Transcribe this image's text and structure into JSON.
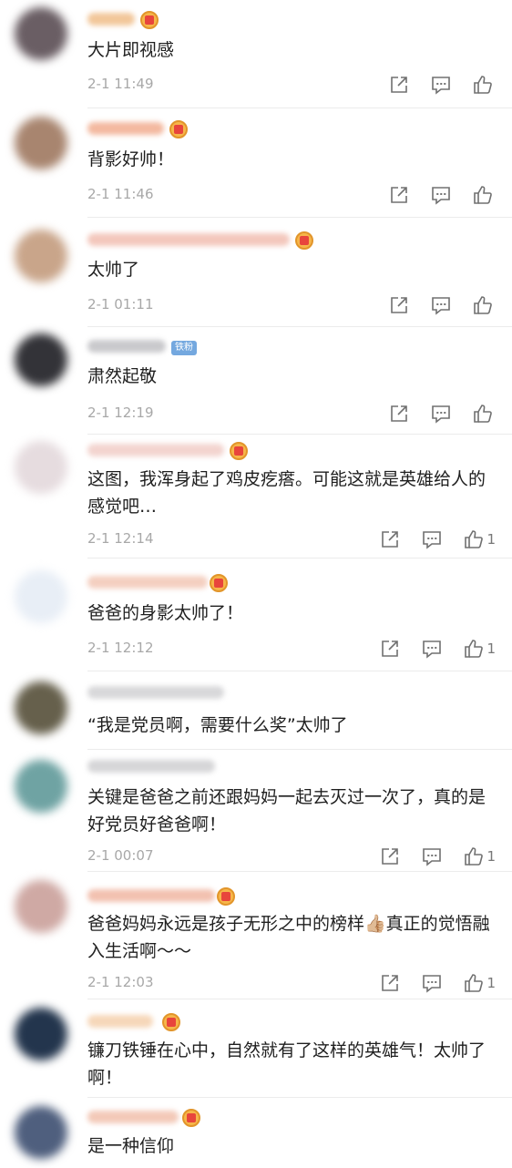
{
  "comments": [
    {
      "text": "大片即视感",
      "time": "2-1 11:49",
      "likes": "",
      "badge": "crown"
    },
    {
      "text": "背影好帅！",
      "time": "2-1 11:46",
      "likes": "",
      "badge": "crown"
    },
    {
      "text": "太帅了",
      "time": "2-1 01:11",
      "likes": "",
      "badge": "crown"
    },
    {
      "text": "肃然起敬",
      "time": "2-1 12:19",
      "likes": "",
      "badge": "fan",
      "badge_label": "铁粉"
    },
    {
      "text": "这图，我浑身起了鸡皮疙瘩。可能这就是英雄给人的感觉吧…",
      "time": "2-1 12:14",
      "likes": "1",
      "badge": "crown"
    },
    {
      "text": "爸爸的身影太帅了！",
      "time": "2-1 12:12",
      "likes": "1",
      "badge": "crown"
    },
    {
      "text": "“我是党员啊，需要什么奖”太帅了",
      "time": "",
      "likes": "",
      "badge": "none"
    },
    {
      "text": "关键是爸爸之前还跟妈妈一起去灭过一次了，真的是好党员好爸爸啊！",
      "time": "2-1 00:07",
      "likes": "1",
      "badge": "none"
    },
    {
      "text": "爸爸妈妈永远是孩子无形之中的榜样👍🏼真正的觉悟融入生活啊～～",
      "time": "2-1 12:03",
      "likes": "1",
      "badge": "crown"
    },
    {
      "text": "镰刀铁锤在心中，自然就有了这样的英雄气！太帅了啊！",
      "time": "",
      "likes": "",
      "badge": "crown"
    },
    {
      "text": "是一种信仰",
      "time": "",
      "likes": "",
      "badge": "crown"
    }
  ],
  "icons": {
    "share": "share-icon",
    "reply": "comment-icon",
    "like": "thumbs-up-icon"
  }
}
